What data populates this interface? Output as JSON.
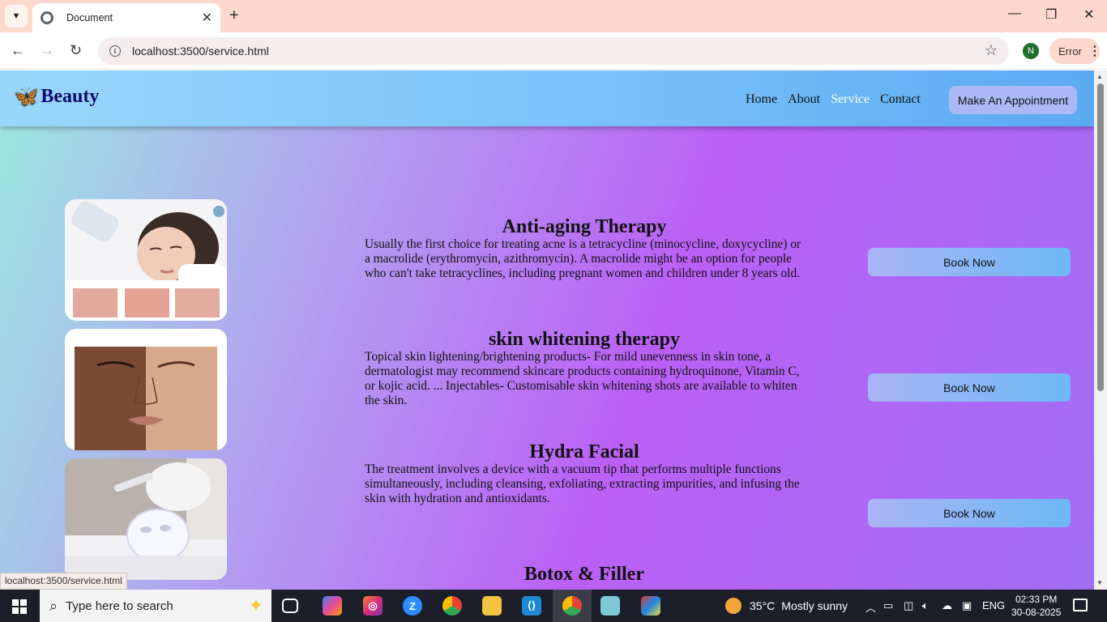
{
  "browser": {
    "tab_title": "Document",
    "url": "localhost:3500/service.html",
    "profile_initial": "N",
    "error_label": "Error",
    "status_link": "localhost:3500/service.html"
  },
  "site": {
    "brand": "Beauty",
    "nav": [
      "Home",
      "About",
      "Service",
      "Contact"
    ],
    "active_nav": "Service",
    "appointment_button": "Make An Appointment"
  },
  "services": [
    {
      "title": "Anti-aging Therapy",
      "description": "Usually the first choice for treating acne is a tetracycline (minocycline, doxycycline) or a macrolide (erythromycin, azithromycin). A macrolide might be an option for people who can't take tetracyclines, including pregnant women and children under 8 years old.",
      "button": "Book Now"
    },
    {
      "title": "skin whitening therapy",
      "description": "Topical skin lightening/brightening products- For mild unevenness in skin tone, a dermatologist may recommend skincare products containing hydroquinone, Vitamin C, or kojic acid. ... Injectables- Customisable skin whitening shots are available to whiten the skin.",
      "button": "Book Now"
    },
    {
      "title": "Hydra Facial",
      "description": "The treatment involves a device with a vacuum tip that performs multiple functions simultaneously, including cleansing, exfoliating, extracting impurities, and infusing the skin with hydration and antioxidants.",
      "button": "Book Now"
    },
    {
      "title": "Botox & Filler",
      "description": "",
      "button": ""
    }
  ],
  "taskbar": {
    "search_placeholder": "Type here to search",
    "weather_temp": "35°C",
    "weather_text": "Mostly sunny",
    "language": "ENG",
    "time": "02:33 PM",
    "date": "30-08-2025"
  },
  "colors": {
    "header_start": "#9ad6fb",
    "header_end": "#5aaaf2",
    "content_left": "#9de6e2",
    "content_mid": "#bb60f6",
    "brand_text": "#0b0b6e"
  }
}
